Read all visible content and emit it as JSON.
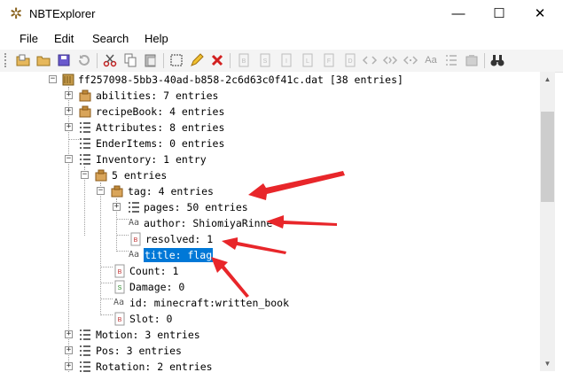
{
  "window": {
    "title": "NBTExplorer",
    "minimize_glyph": "—",
    "maximize_glyph": "☐",
    "close_glyph": "✕"
  },
  "menu": [
    "File",
    "Edit",
    "Search",
    "Help"
  ],
  "toolbar": {
    "buttons": [
      "open-folder-icon",
      "open-folder-icon",
      "save-icon",
      "refresh-icon",
      "cut-icon",
      "copy-icon",
      "paste-icon",
      "rename-icon",
      "edit-icon",
      "delete-icon",
      "add-byte-icon",
      "add-short-icon",
      "add-int-icon",
      "add-long-icon",
      "add-float-icon",
      "add-double-icon",
      "add-byte-array-icon",
      "add-int-array-icon",
      "add-long-array-icon",
      "add-string-icon",
      "add-list-icon",
      "add-compound-icon",
      "find-icon"
    ],
    "string_glyph": "Aa"
  },
  "tree": {
    "root": "ff257098-5bb3-40ad-b858-2c6d63c0f41c.dat [38 entries]",
    "abilities": "abilities: 7 entries",
    "recipeBook": "recipeBook: 4 entries",
    "attributes": "Attributes: 8 entries",
    "enderItems": "EnderItems: 0 entries",
    "inventory": "Inventory: 1 entry",
    "inv_item": "5 entries",
    "tag": "tag: 4 entries",
    "pages": "pages: 50 entries",
    "author": "author: ShiomiyaRinne",
    "resolved": "resolved: 1",
    "title": "title: flag",
    "count": "Count: 1",
    "damage": "Damage: 0",
    "id": "id: minecraft:written_book",
    "slot": "Slot: 0",
    "motion": "Motion: 3 entries",
    "pos": "Pos: 3 entries",
    "rotation": "Rotation: 2 entries"
  },
  "glyphs": {
    "plus": "+",
    "minus": "−",
    "scroll_up": "▲",
    "scroll_down": "▼",
    "byte_tag": "B",
    "short_tag": "S",
    "string_tag": "Aa"
  },
  "colors": {
    "selection": "#0078d7",
    "annotation_arrow": "#e8262a",
    "compound_icon": "#d9a55a",
    "delete_icon": "#d22020"
  }
}
